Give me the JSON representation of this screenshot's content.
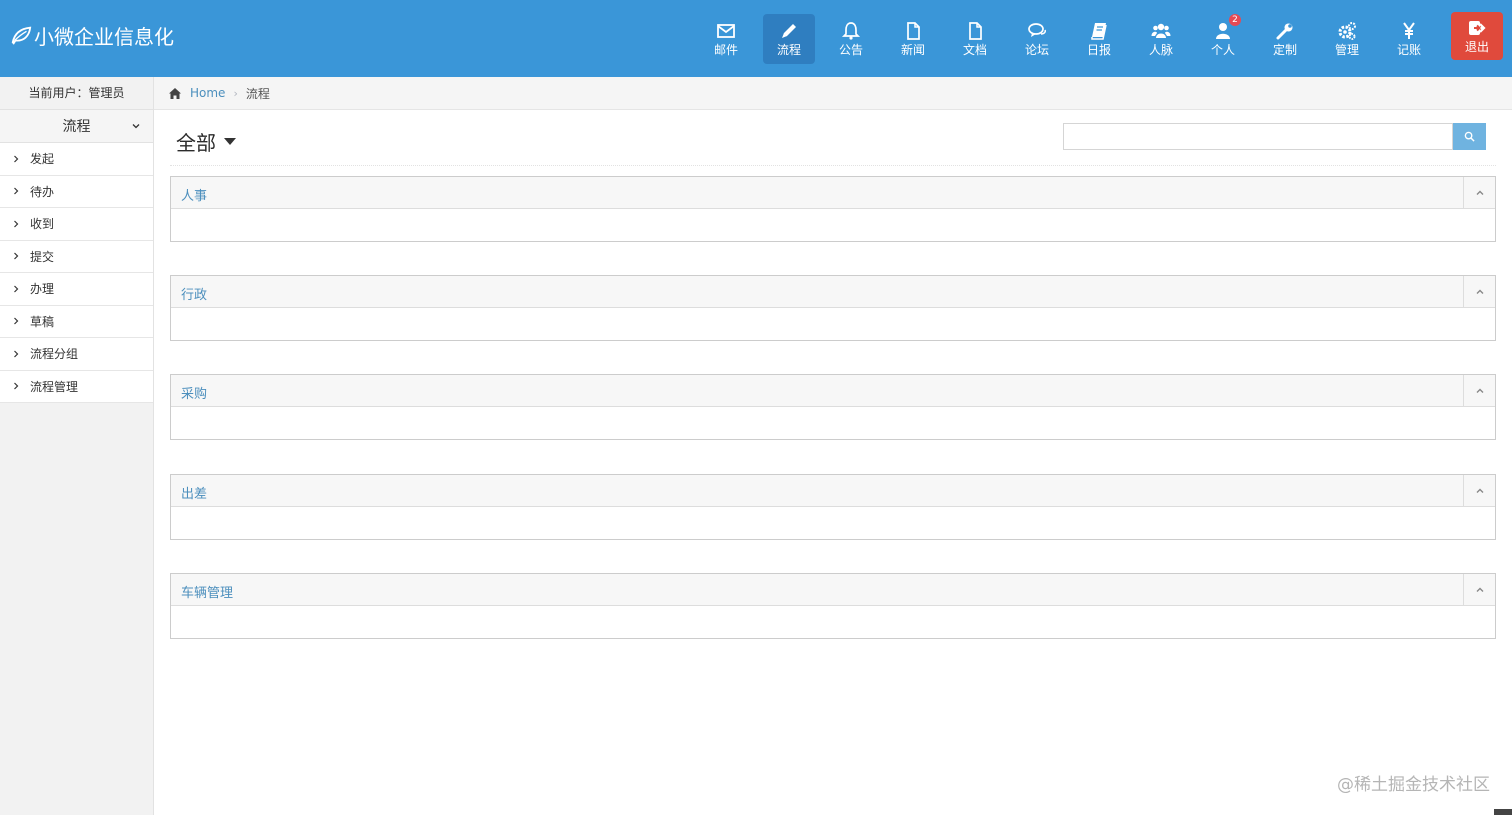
{
  "brand": {
    "title": "小微企业信息化"
  },
  "nav": {
    "items": [
      {
        "key": "mail",
        "label": "邮件",
        "icon": "envelope-icon",
        "active": false
      },
      {
        "key": "flow",
        "label": "流程",
        "icon": "pencil-icon",
        "active": true
      },
      {
        "key": "notice",
        "label": "公告",
        "icon": "bell-icon",
        "active": false
      },
      {
        "key": "news",
        "label": "新闻",
        "icon": "file-icon",
        "active": false
      },
      {
        "key": "docs",
        "label": "文档",
        "icon": "document-icon",
        "active": false
      },
      {
        "key": "forum",
        "label": "论坛",
        "icon": "comments-icon",
        "active": false
      },
      {
        "key": "daily",
        "label": "日报",
        "icon": "book-icon",
        "active": false
      },
      {
        "key": "contacts",
        "label": "人脉",
        "icon": "users-icon",
        "active": false
      },
      {
        "key": "personal",
        "label": "个人",
        "icon": "user-icon",
        "active": false,
        "badge": "2"
      },
      {
        "key": "custom",
        "label": "定制",
        "icon": "wrench-icon",
        "active": false
      },
      {
        "key": "admin",
        "label": "管理",
        "icon": "cogs-icon",
        "active": false
      },
      {
        "key": "ledger",
        "label": "记账",
        "icon": "yen-icon",
        "active": false
      }
    ],
    "logout": {
      "label": "退出",
      "icon": "sign-out-icon"
    }
  },
  "sidebar": {
    "current_user": "当前用户：管理员",
    "section": "流程",
    "items": [
      {
        "label": "发起"
      },
      {
        "label": "待办"
      },
      {
        "label": "收到"
      },
      {
        "label": "提交"
      },
      {
        "label": "办理"
      },
      {
        "label": "草稿"
      },
      {
        "label": "流程分组"
      },
      {
        "label": "流程管理"
      }
    ]
  },
  "breadcrumb": {
    "home": "Home",
    "current": "流程"
  },
  "header": {
    "scope": "全部",
    "search": {
      "value": "",
      "placeholder": ""
    }
  },
  "panels": [
    {
      "title": "人事"
    },
    {
      "title": "行政"
    },
    {
      "title": "采购"
    },
    {
      "title": "出差"
    },
    {
      "title": "车辆管理"
    }
  ],
  "watermark": "@稀土掘金技术社区",
  "colors": {
    "navbar": "#3a96d8",
    "active": "#2f7ec0",
    "logout": "#e04a3c",
    "link": "#4c8fbd",
    "badge": "#e54a55"
  }
}
